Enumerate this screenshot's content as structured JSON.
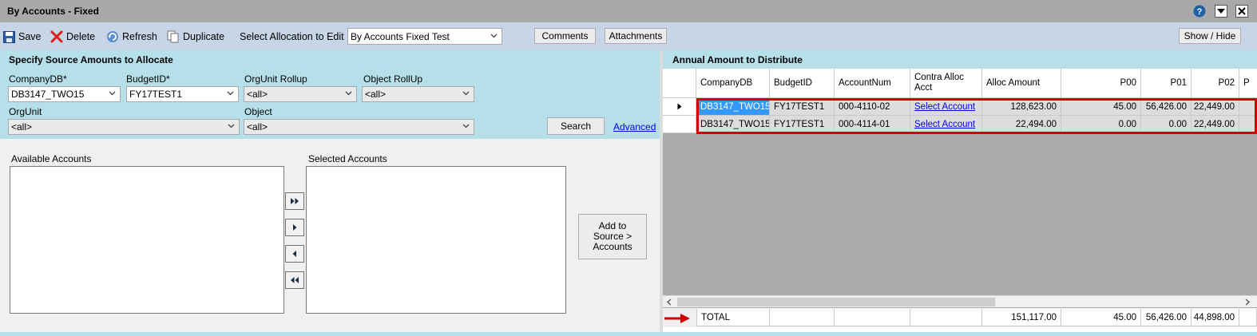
{
  "window": {
    "title": "By Accounts - Fixed",
    "icons": [
      "help-icon",
      "dropdown-icon",
      "close-icon"
    ]
  },
  "toolbar": {
    "save": "Save",
    "delete": "Delete",
    "refresh": "Refresh",
    "duplicate": "Duplicate",
    "select_allocation_label": "Select Allocation to Edit",
    "allocation_value": "By Accounts Fixed Test",
    "comments": "Comments",
    "attachments": "Attachments",
    "show_hide": "Show / Hide"
  },
  "source": {
    "title": "Specify Source Amounts to Allocate",
    "companydb_label": "CompanyDB*",
    "companydb_value": "DB3147_TWO15",
    "budgetid_label": "BudgetID*",
    "budgetid_value": "FY17TEST1",
    "orgunit_rollup_label": "OrgUnit Rollup",
    "orgunit_rollup_value": "<all>",
    "object_rollup_label": "Object RollUp",
    "object_rollup_value": "<all>",
    "orgunit_label": "OrgUnit",
    "orgunit_value": "<all>",
    "object_label": "Object",
    "object_value": "<all>",
    "search": "Search",
    "advanced": "Advanced",
    "available_label": "Available Accounts",
    "selected_label": "Selected Accounts",
    "add_button": "Add to Source > Accounts"
  },
  "distribute": {
    "title": "Annual Amount to Distribute",
    "columns": [
      "CompanyDB",
      "BudgetID",
      "AccountNum",
      "Contra Alloc Acct",
      "Alloc Amount",
      "P00",
      "P01",
      "P02",
      "P"
    ],
    "rows": [
      {
        "companydb": "DB3147_TWO15",
        "budgetid": "FY17TEST1",
        "accountnum": "000-4110-02",
        "contra": "Select Account",
        "alloc": "128,623.00",
        "p00": "45.00",
        "p01": "56,426.00",
        "p02": "22,449.00"
      },
      {
        "companydb": "DB3147_TWO15",
        "budgetid": "FY17TEST1",
        "accountnum": "000-4114-01",
        "contra": "Select Account",
        "alloc": "22,494.00",
        "p00": "0.00",
        "p01": "0.00",
        "p02": "22,449.00"
      }
    ],
    "totals": {
      "label": "TOTAL",
      "alloc": "151,117.00",
      "p00": "45.00",
      "p01": "56,426.00",
      "p02": "44,898.00"
    }
  },
  "colors": {
    "highlight": "#d40000",
    "selection": "#3399ff",
    "panel": "#b5e0ea",
    "toolbar": "#c7d5e6"
  }
}
